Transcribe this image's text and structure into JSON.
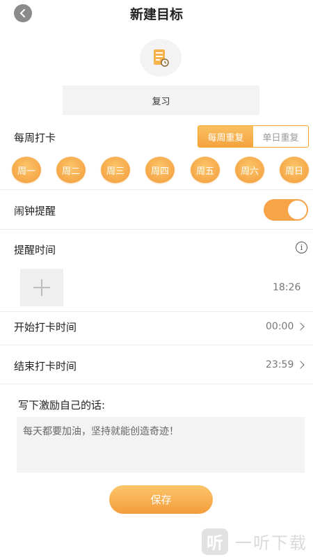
{
  "header": {
    "title": "新建目标",
    "back_icon": "chevron-left-icon"
  },
  "goal": {
    "icon": "notebook-icon",
    "name": "复习"
  },
  "weekly_checkin": {
    "label": "每周打卡",
    "options": [
      "每周重复",
      "单日重复"
    ],
    "selected": "每周重复",
    "days": [
      "周一",
      "周二",
      "周三",
      "周四",
      "周五",
      "周六",
      "周日"
    ]
  },
  "alarm": {
    "label": "闹钟提醒",
    "enabled": true
  },
  "reminder": {
    "label": "提醒时间",
    "info_icon": "info-icon",
    "add_icon": "plus-icon",
    "time": "18:26"
  },
  "start_time": {
    "label": "开始打卡时间",
    "value": "00:00"
  },
  "end_time": {
    "label": "结束打卡时间",
    "value": "23:59"
  },
  "motto": {
    "label": "写下激励自己的话:",
    "placeholder": "每天都要加油，坚持就能创造奇迹！"
  },
  "save_label": "保存",
  "watermark": {
    "logo": "听",
    "text": "一听下载"
  },
  "colors": {
    "accent": "#f5a33e",
    "accent_light": "#fbc56a"
  }
}
